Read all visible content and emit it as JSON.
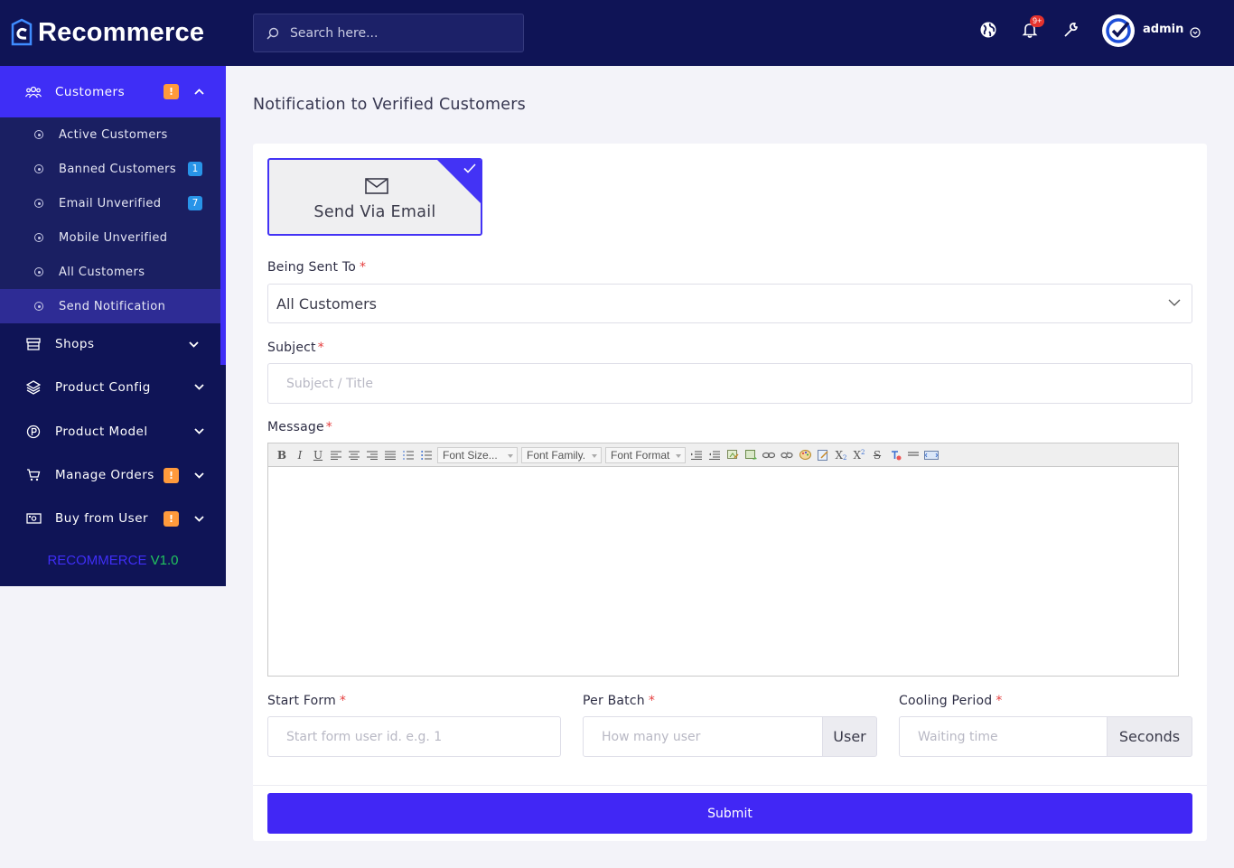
{
  "brand": {
    "name": "Recommerce"
  },
  "search": {
    "placeholder": "Search here..."
  },
  "header": {
    "notification_count": "9+",
    "user_name": "admin",
    "icons": [
      "globe-icon",
      "bell-icon",
      "wrench-icon",
      "chevron-down-icon"
    ]
  },
  "sidebar": {
    "customers": {
      "label": "Customers",
      "badge": "!",
      "items": [
        {
          "label": "Active Customers",
          "count": ""
        },
        {
          "label": "Banned Customers",
          "count": "1"
        },
        {
          "label": "Email Unverified",
          "count": "7"
        },
        {
          "label": "Mobile Unverified",
          "count": ""
        },
        {
          "label": "All Customers",
          "count": ""
        },
        {
          "label": "Send Notification",
          "count": "",
          "active": true
        }
      ]
    },
    "shops": {
      "label": "Shops"
    },
    "product_config": {
      "label": "Product Config"
    },
    "product_model": {
      "label": "Product Model"
    },
    "manage_orders": {
      "label": "Manage Orders",
      "badge": "!"
    },
    "buy_from_user": {
      "label": "Buy from User",
      "badge": "!"
    },
    "version_name": "RECOMMERCE",
    "version_number": "V1.0"
  },
  "page": {
    "title": "Notification to Verified Customers"
  },
  "form": {
    "channel_label": "Send Via Email",
    "being_sent_to_label": "Being Sent To",
    "being_sent_to_value": "All Customers",
    "subject_label": "Subject",
    "subject_placeholder": "Subject / Title",
    "message_label": "Message",
    "editor_toolbar": {
      "bold": "B",
      "italic": "I",
      "underline": "U",
      "font_size": "Font Size...",
      "font_family": "Font Family.",
      "font_format": "Font Format",
      "subscript": "X",
      "superscript": "X"
    },
    "start_form_label": "Start Form",
    "start_form_placeholder": "Start form user id. e.g. 1",
    "per_batch_label": "Per Batch",
    "per_batch_placeholder": "How many user",
    "per_batch_addon": "User",
    "cooling_label": "Cooling Period",
    "cooling_placeholder": "Waiting time",
    "cooling_addon": "Seconds",
    "required_mark": "*",
    "submit_label": "Submit"
  },
  "colors": {
    "sidebar": "#0f1456",
    "accent": "#3f2ef6",
    "warning": "#ff9a3c",
    "info": "#2894e8",
    "version_green": "#22c55e"
  }
}
